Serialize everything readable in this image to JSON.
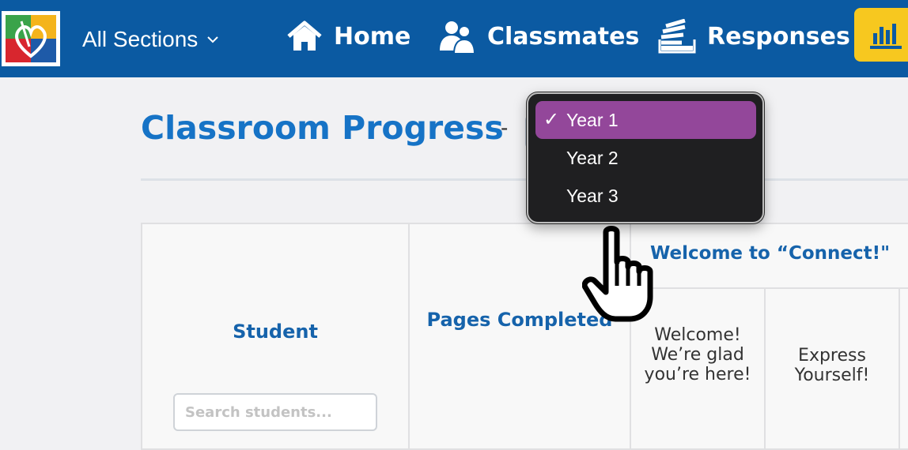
{
  "header": {
    "sections_label": "All Sections",
    "nav": [
      {
        "label": "Home",
        "icon": "home-icon"
      },
      {
        "label": "Classmates",
        "icon": "classmates-icon"
      },
      {
        "label": "Responses",
        "icon": "responses-icon"
      },
      {
        "label": "",
        "icon": "bar-chart-icon",
        "active": true
      }
    ],
    "colors": {
      "bar": "#0b5aa2",
      "active_tab": "#f7c81f"
    }
  },
  "page": {
    "title": "Classroom Progress",
    "separator": "-"
  },
  "year_dropdown": {
    "selected": "Year 1",
    "check": "✓",
    "options": [
      "Year 1",
      "Year 2",
      "Year 3"
    ],
    "highlight_color": "#93479a"
  },
  "table": {
    "student_header": "Student",
    "search_placeholder": "Search students...",
    "pages_header": "Pages Completed",
    "group_header": "Welcome to “Connect!\"",
    "subheaders": [
      "Welcome! We’re glad you’re here!",
      "Express Yourself!"
    ]
  }
}
